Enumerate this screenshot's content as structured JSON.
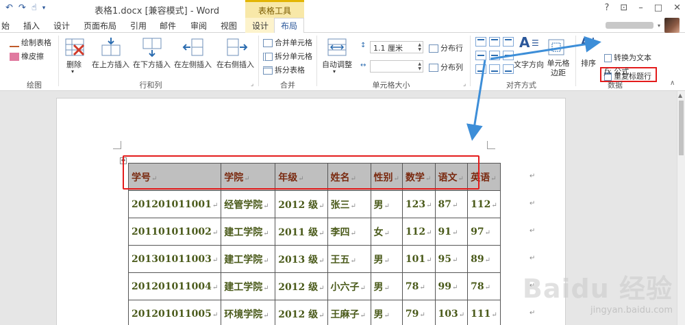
{
  "titlebar": {
    "doc_title": "表格1.docx [兼容模式] - Word",
    "context_tab_header": "表格工具",
    "help": "?",
    "min": "–",
    "max": "□",
    "close": "✕"
  },
  "tabs": [
    {
      "label": "始"
    },
    {
      "label": "插入"
    },
    {
      "label": "设计"
    },
    {
      "label": "页面布局"
    },
    {
      "label": "引用"
    },
    {
      "label": "邮件"
    },
    {
      "label": "审阅"
    },
    {
      "label": "视图"
    },
    {
      "label": "设计"
    },
    {
      "label": "布局"
    }
  ],
  "ribbon": {
    "draw": {
      "draw_table": "绘制表格",
      "eraser": "橡皮擦",
      "label": "绘图"
    },
    "rows_cols": {
      "delete": "删除",
      "insert_above": "在上方插入",
      "insert_below": "在下方插入",
      "insert_left": "在左侧插入",
      "insert_right": "在右侧插入",
      "label": "行和列"
    },
    "merge": {
      "merge_cells": "合并单元格",
      "split_cells": "拆分单元格",
      "split_table": "拆分表格",
      "label": "合并"
    },
    "cell_size": {
      "autofit": "自动调整",
      "height_value": "1.1 厘米",
      "width_value": "",
      "distribute_rows": "分布行",
      "distribute_cols": "分布列",
      "label": "单元格大小"
    },
    "alignment": {
      "text_direction": "文字方向",
      "cell_margins": "单元格边距",
      "label": "对齐方式"
    },
    "data": {
      "sort": "排序",
      "repeat_header": "重复标题行",
      "convert_to_text": "转换为文本",
      "formula": "公式",
      "label": "数据"
    }
  },
  "table": {
    "headers": [
      "学号",
      "学院",
      "年级",
      "姓名",
      "性别",
      "数学",
      "语文",
      "英语"
    ],
    "rows": [
      [
        "201201011001",
        "经管学院",
        "2012 级",
        "张三",
        "男",
        "123",
        "87",
        "112"
      ],
      [
        "201101011002",
        "建工学院",
        "2011 级",
        "李四",
        "女",
        "112",
        "91",
        "97"
      ],
      [
        "201301011003",
        "建工学院",
        "2013 级",
        "王五",
        "男",
        "101",
        "95",
        "89"
      ],
      [
        "201201011004",
        "建工学院",
        "2012 级",
        "小六子",
        "男",
        "78",
        "99",
        "78"
      ],
      [
        "201201011005",
        "环境学院",
        "2012 级",
        "王麻子",
        "男",
        "79",
        "103",
        "111"
      ]
    ]
  },
  "watermark": {
    "logo": "Baidu 经验",
    "url": "jingyan.baidu.com"
  },
  "colors": {
    "accent": "#2b579a",
    "highlight": "#e31b1b",
    "arrow": "#3d8ed8",
    "header_bg": "#bfbfbf"
  }
}
